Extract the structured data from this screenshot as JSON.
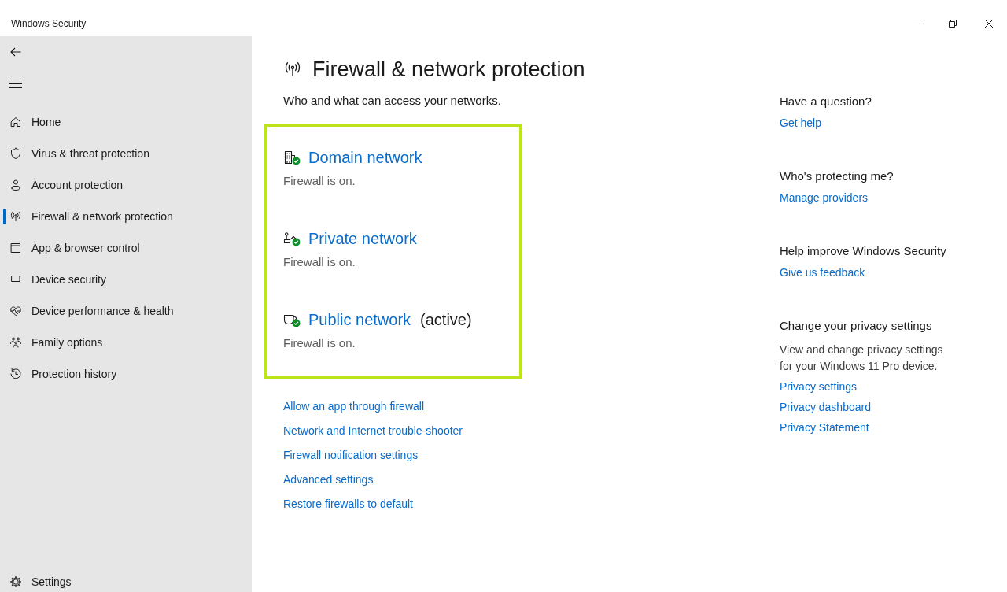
{
  "window": {
    "title": "Windows Security"
  },
  "sidebar": {
    "items": [
      {
        "label": "Home",
        "selected": false
      },
      {
        "label": "Virus & threat protection",
        "selected": false
      },
      {
        "label": "Account protection",
        "selected": false
      },
      {
        "label": "Firewall & network protection",
        "selected": true
      },
      {
        "label": "App & browser control",
        "selected": false
      },
      {
        "label": "Device security",
        "selected": false
      },
      {
        "label": "Device performance & health",
        "selected": false
      },
      {
        "label": "Family options",
        "selected": false
      },
      {
        "label": "Protection history",
        "selected": false
      }
    ],
    "footer": {
      "label": "Settings"
    }
  },
  "page": {
    "title": "Firewall & network protection",
    "subtitle": "Who and what can access your networks."
  },
  "networks": [
    {
      "name": "Domain network",
      "status": "Firewall is on.",
      "firewall_on": true
    },
    {
      "name": "Private network",
      "status": "Firewall is on.",
      "firewall_on": true
    },
    {
      "name": "Public network",
      "note": "(active)",
      "status": "Firewall is on.",
      "firewall_on": true
    }
  ],
  "links": [
    "Allow an app through firewall",
    "Network and Internet trouble-shooter",
    "Firewall notification settings",
    "Advanced settings",
    "Restore firewalls to default"
  ],
  "aside": [
    {
      "heading": "Have a question?",
      "links": [
        "Get help"
      ]
    },
    {
      "heading": "Who's protecting me?",
      "links": [
        "Manage providers"
      ]
    },
    {
      "heading": "Help improve Windows Security",
      "links": [
        "Give us feedback"
      ]
    },
    {
      "heading": "Change your privacy settings",
      "text": "View and change privacy settings for your Windows 11 Pro device.",
      "links": [
        "Privacy settings",
        "Privacy dashboard",
        "Privacy Statement"
      ]
    }
  ]
}
